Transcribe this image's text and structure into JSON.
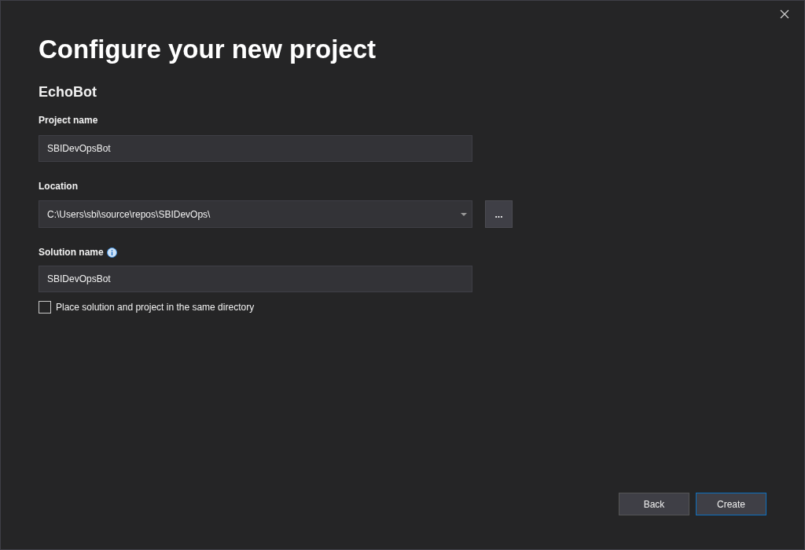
{
  "title": "Configure your new project",
  "template": "EchoBot",
  "project_name": {
    "label": "Project name",
    "value": "SBIDevOpsBot"
  },
  "location": {
    "label": "Location",
    "value": "C:\\Users\\sbi\\source\\repos\\SBIDevOps\\",
    "browse": "..."
  },
  "solution_name": {
    "label": "Solution name",
    "value": "SBIDevOpsBot"
  },
  "same_directory": {
    "label": "Place solution and project in the same directory",
    "checked": false
  },
  "buttons": [
    {
      "label": "Back",
      "focused": false
    },
    {
      "label": "Create",
      "focused": true
    }
  ]
}
